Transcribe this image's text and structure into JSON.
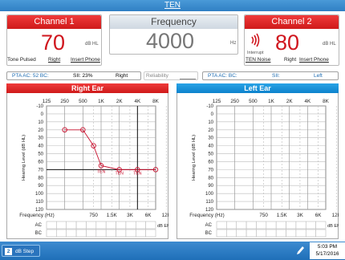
{
  "title": "TEN",
  "channel1": {
    "header": "Channel 1",
    "value": "70",
    "unit": "dB HL",
    "stimulus": "Tone Pulsed",
    "ear": "Right",
    "transducer": "Insert Phone"
  },
  "frequency": {
    "header": "Frequency",
    "value": "4000",
    "unit": "Hz"
  },
  "channel2": {
    "header": "Channel 2",
    "value": "80",
    "unit": "dB HL",
    "interrupt": "Interrupt",
    "stimulus": "TEN Noise",
    "ear": "Right",
    "transducer": "Insert Phone"
  },
  "right_info": {
    "pta": "PTA  AC: 52  BC:",
    "sii": "SII: 23%",
    "ear": "Right",
    "reliability": "Reliability"
  },
  "left_info": {
    "pta": "PTA  AC:  BC:",
    "sii": "SII:",
    "ear": "Left"
  },
  "right_ear": {
    "title": "Right Ear",
    "ylabel": "Hearing Level (dB HL)",
    "xlabel": "Frequency (Hz)",
    "em_label": "dB EM",
    "ac_label": "AC",
    "bc_label": "BC"
  },
  "left_ear": {
    "title": "Left Ear",
    "ylabel": "Hearing Level (dB HL)",
    "xlabel": "Frequency (Hz)",
    "em_label": "dB EM",
    "ac_label": "AC",
    "bc_label": "BC"
  },
  "chart_data": [
    {
      "type": "line",
      "title": "Right Ear",
      "xlabel": "Frequency (Hz)",
      "ylabel": "Hearing Level (dB HL)",
      "top_ticks": [
        "125",
        "250",
        "500",
        "1K",
        "2K",
        "4K",
        "8K"
      ],
      "bottom_ticks": [
        "750",
        "1.5K",
        "3K",
        "6K",
        "12K"
      ],
      "yticks": [
        -10,
        0,
        10,
        20,
        30,
        40,
        50,
        60,
        70,
        80,
        90,
        100,
        110,
        120
      ],
      "ylim": [
        -10,
        120
      ],
      "series": [
        {
          "x": [
            250,
            500,
            750,
            1000,
            2000,
            4000,
            8000
          ],
          "values": [
            20,
            20,
            40,
            65,
            70,
            70,
            70
          ]
        }
      ],
      "annotations": [
        "TEN",
        "TEN",
        "TEN"
      ],
      "marker_line": {
        "x": 4000
      }
    },
    {
      "type": "line",
      "title": "Left Ear",
      "xlabel": "Frequency (Hz)",
      "ylabel": "Hearing Level (dB HL)",
      "top_ticks": [
        "125",
        "250",
        "500",
        "1K",
        "2K",
        "4K",
        "8K"
      ],
      "bottom_ticks": [
        "750",
        "1.5K",
        "3K",
        "6K",
        "12K"
      ],
      "yticks": [
        -10,
        0,
        10,
        20,
        30,
        40,
        50,
        60,
        70,
        80,
        90,
        100,
        110,
        120
      ],
      "ylim": [
        -10,
        120
      ],
      "series": []
    }
  ],
  "bottom": {
    "step_value": "2",
    "step_label": "dB Step",
    "time": "5:03 PM",
    "date": "5/17/2016"
  }
}
